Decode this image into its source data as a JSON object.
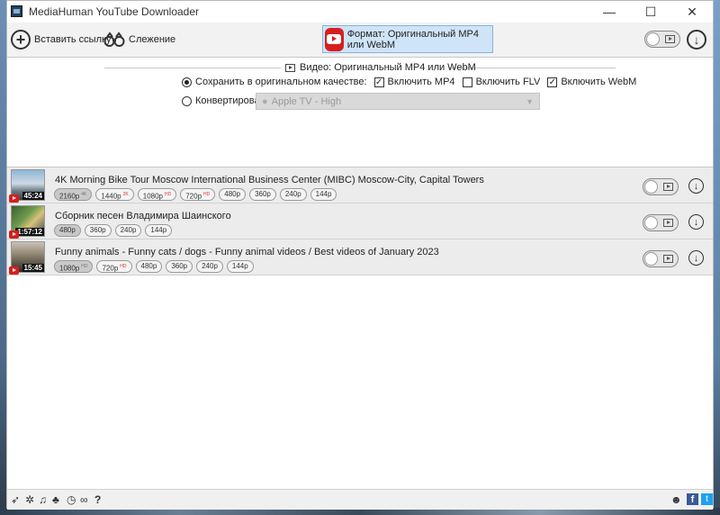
{
  "window": {
    "title": "MediaHuman YouTube Downloader",
    "controls": {
      "minimize": "—",
      "maximize": "☐",
      "close": "✕"
    }
  },
  "toolbar": {
    "paste_label": "Вставить ссылку",
    "tracking_label": "Слежение",
    "format_label": "Формат: Оригинальный MP4 или WebM"
  },
  "settings": {
    "header": "Видео: Оригинальный MP4 или WebM",
    "keep_original_label": "Сохранить в оригинальном качестве:",
    "include_mp4_label": "Включить MP4",
    "include_flv_label": "Включить FLV",
    "include_webm_label": "Включить WebM",
    "convert_label": "Конвертировать в:",
    "convert_value": "Apple TV - High",
    "keep_original_selected": true,
    "include_mp4_checked": true,
    "include_flv_checked": false,
    "include_webm_checked": true
  },
  "videos": [
    {
      "title": "4K Morning Bike Tour Moscow International Business Center (MIBC) Moscow-City, Capital Towers",
      "duration": "45:24",
      "qualities": [
        {
          "label": "2160p",
          "badge": "4K"
        },
        {
          "label": "1440p",
          "badge": "2K"
        },
        {
          "label": "1080p",
          "badge": "HD"
        },
        {
          "label": "720p",
          "badge": "HD"
        },
        {
          "label": "480p",
          "badge": ""
        },
        {
          "label": "360p",
          "badge": ""
        },
        {
          "label": "240p",
          "badge": ""
        },
        {
          "label": "144p",
          "badge": ""
        }
      ]
    },
    {
      "title": "Сборник песен Владимира Шаинского",
      "duration": "1:57:12",
      "qualities": [
        {
          "label": "480p",
          "badge": ""
        },
        {
          "label": "360p",
          "badge": ""
        },
        {
          "label": "240p",
          "badge": ""
        },
        {
          "label": "144p",
          "badge": ""
        }
      ]
    },
    {
      "title": "Funny animals - Funny cats / dogs - Funny animal videos / Best videos of January 2023",
      "duration": "15:45",
      "qualities": [
        {
          "label": "1080p",
          "badge": "HD"
        },
        {
          "label": "720p",
          "badge": "HD"
        },
        {
          "label": "480p",
          "badge": ""
        },
        {
          "label": "360p",
          "badge": ""
        },
        {
          "label": "240p",
          "badge": ""
        },
        {
          "label": "144p",
          "badge": ""
        }
      ]
    }
  ],
  "colors": {
    "accent": "#cfe4f7",
    "youtube_red": "#d71e1e",
    "facebook": "#3b5998",
    "twitter": "#1da1f2"
  },
  "bottom_icons": [
    "send-icon",
    "gear-icon",
    "music-icon",
    "bird-icon",
    "clock-icon",
    "binoculars-icon",
    "help-icon"
  ]
}
